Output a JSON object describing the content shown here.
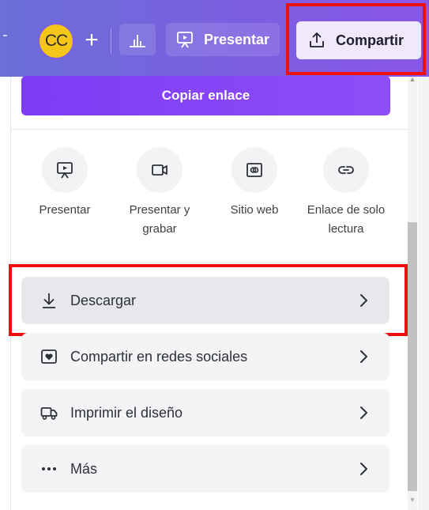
{
  "header": {
    "avatar_initials": "CC",
    "add_label": "+",
    "present_label": "Presentar",
    "share_label": "Compartir"
  },
  "share_panel": {
    "copy_link_label": "Copiar enlace",
    "options": [
      {
        "icon": "present-icon",
        "label": "Presentar"
      },
      {
        "icon": "record-icon",
        "label": "Presentar y grabar"
      },
      {
        "icon": "website-icon",
        "label": "Sitio web"
      },
      {
        "icon": "link-icon",
        "label": "Enlace de solo lectura"
      }
    ],
    "rows": [
      {
        "icon": "download-icon",
        "label": "Descargar",
        "active": true
      },
      {
        "icon": "heart-icon",
        "label": "Compartir en redes sociales",
        "active": false
      },
      {
        "icon": "print-truck-icon",
        "label": "Imprimir el diseño",
        "active": false
      },
      {
        "icon": "more-icon",
        "label": "Más",
        "active": false
      }
    ]
  },
  "colors": {
    "header_gradient_start": "#6b6fd8",
    "header_gradient_end": "#8a56e6",
    "copy_button": "#7d3cf5",
    "highlight_box": "#ee0f0f",
    "avatar": "#f5c518"
  }
}
